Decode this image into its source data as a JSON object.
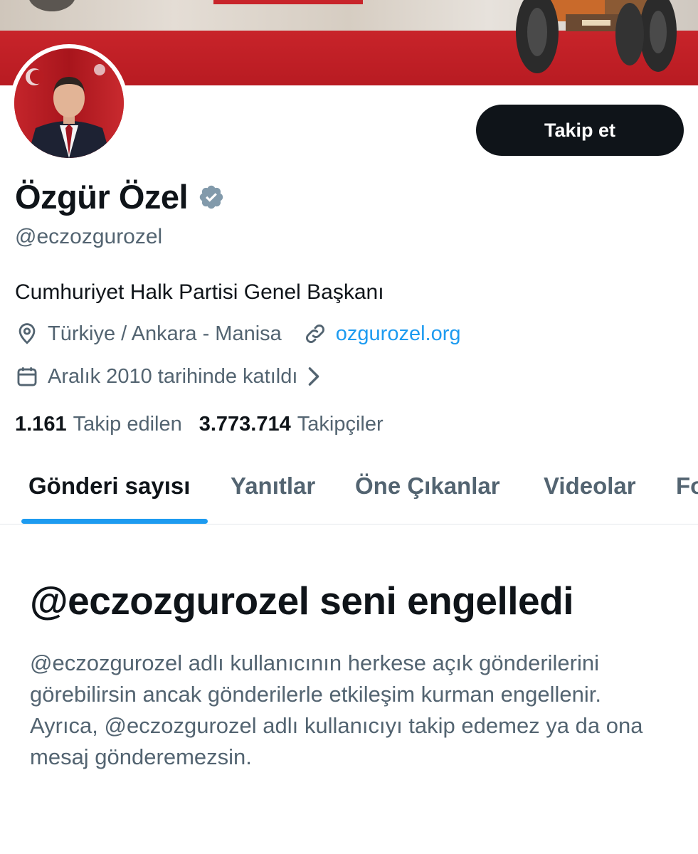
{
  "profile": {
    "display_name": "Özgür Özel",
    "handle": "@eczozgurozel",
    "bio": "Cumhuriyet Halk Partisi Genel Başkanı",
    "location": "Türkiye / Ankara - Manisa",
    "website": "ozgurozel.org",
    "joined": "Aralık 2010 tarihinde katıldı",
    "verified": true,
    "badge_color": "#829aab"
  },
  "actions": {
    "follow_label": "Takip et"
  },
  "stats": {
    "following_count": "1.161",
    "following_label": "Takip edilen",
    "followers_count": "3.773.714",
    "followers_label": "Takipçiler"
  },
  "tabs": [
    {
      "label": "Gönderi sayısı",
      "active": true
    },
    {
      "label": "Yanıtlar",
      "active": false
    },
    {
      "label": "Öne Çıkanlar",
      "active": false
    },
    {
      "label": "Videolar",
      "active": false
    },
    {
      "label": "Fo",
      "active": false
    }
  ],
  "blocked": {
    "title": "@eczozgurozel seni engelledi",
    "body": "@eczozgurozel adlı kullanıcının herkese açık gönderilerini görebilirsin ancak gönderilerle etkileşim kurman engellenir. Ayrıca, @eczozgurozel adlı kullanıcıyı takip edemez ya da ona mesaj gönderemezsin."
  },
  "colors": {
    "accent": "#1d9bf0",
    "text_primary": "#0f1419",
    "text_secondary": "#536471",
    "banner_red": "#c8242a"
  },
  "icons": [
    "location-pin-icon",
    "link-icon",
    "calendar-icon",
    "chevron-right-icon",
    "verified-badge-icon"
  ]
}
